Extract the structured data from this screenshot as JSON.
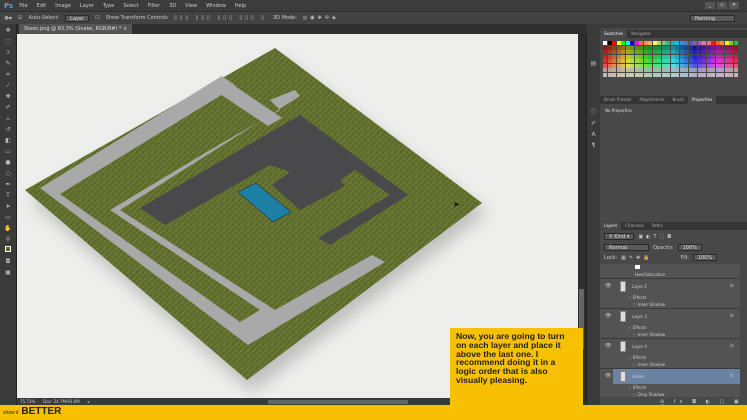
{
  "app": {
    "logo": "Ps",
    "menu": [
      "File",
      "Edit",
      "Image",
      "Layer",
      "Type",
      "Select",
      "Filter",
      "3D",
      "View",
      "Window",
      "Help"
    ]
  },
  "options": {
    "auto_select_label": "Auto-Select:",
    "auto_select_value": "Layer",
    "show_transform_label": "Show Transform Controls",
    "mode_3d": "3D Mode:",
    "workspace": "Painting"
  },
  "document": {
    "tab_title": "Steen.png @ 83.3% (Snake, RGB/8#) *"
  },
  "status": {
    "zoom": "75.73%",
    "doc": "Doc: 24.7M/93.6M"
  },
  "swatches": {
    "tabs": [
      "Swatches",
      "Navigator"
    ],
    "colors": [
      "#ffffff",
      "#000000",
      "#ff0000",
      "#ffff00",
      "#00ff00",
      "#00ffff",
      "#0000ff",
      "#ff00ff",
      "#f26c4f",
      "#f68e56",
      "#fbaf5d",
      "#fff568",
      "#acd372",
      "#7cc576",
      "#3bb878",
      "#1abbb4",
      "#00bff3",
      "#438ccb",
      "#5574b9",
      "#605ca8",
      "#855fa8",
      "#a763a8",
      "#f06ea9",
      "#f26d7d",
      "#ed1c24",
      "#f26522",
      "#f7941d",
      "#fff200",
      "#8dc73f",
      "#39b54a"
    ]
  },
  "properties": {
    "tabs": [
      "Brush Presets",
      "Adjustments",
      "Brush",
      "Properties"
    ],
    "active": "Properties",
    "body": "No Properties"
  },
  "layers": {
    "tabs": [
      "Layers",
      "Channels",
      "Paths"
    ],
    "kind": "Kind",
    "blend": "Normal",
    "opacity_label": "Opacity:",
    "opacity": "100%",
    "lock_label": "Lock:",
    "fill_label": "Fill:",
    "fill": "100%",
    "items": [
      {
        "name": "Hue/Saturation",
        "type": "adjustment"
      },
      {
        "name": "Layer 2",
        "effects": "Effects",
        "effect": "Inner Shadow"
      },
      {
        "name": "Layer 3",
        "effects": "Effects",
        "effect": "Inner Shadow"
      },
      {
        "name": "Layer 4",
        "effects": "Effects",
        "effect": "Inner Shadow"
      },
      {
        "name": "Snake",
        "effects": "Effects",
        "effect": "Drop Shadow",
        "selected": true
      }
    ]
  },
  "callout": {
    "text": "Now, you are going to turn on each layer and place it above the last one. I recommend doing it in a logic order that is also visually pleasing."
  },
  "branding": {
    "small": "show it",
    "big": "BETTER"
  },
  "colors": {
    "accent": "#f7c003",
    "grass": "#5d6b2c",
    "path": "#a9a9a9",
    "building": "#49494b",
    "pool": "#1d7fa3",
    "selected_layer": "#6b83a3"
  }
}
